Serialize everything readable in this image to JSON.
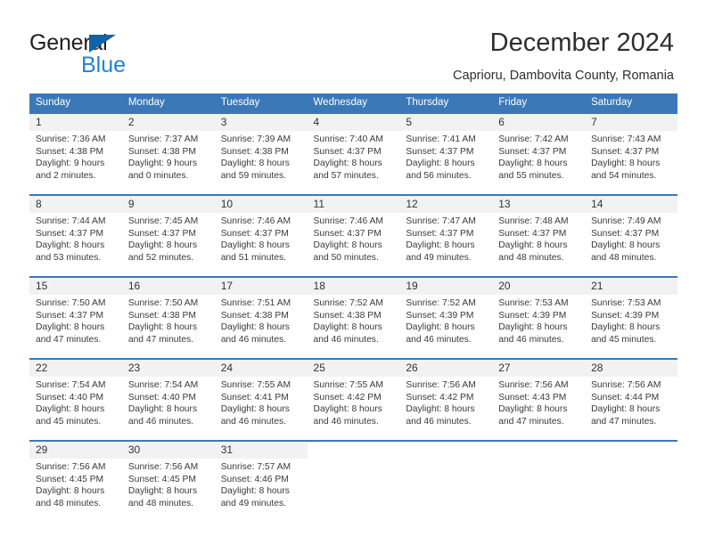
{
  "brand": {
    "name_part1": "General",
    "name_part2": "Blue"
  },
  "header": {
    "title": "December 2024",
    "subtitle": "Caprioru, Dambovita County, Romania"
  },
  "colors": {
    "header_blue": "#3b78b8",
    "logo_blue": "#1e84d6",
    "logo_triangle": "#1063a8",
    "daynum_background": "#f2f2f2"
  },
  "weekday_headers": [
    "Sunday",
    "Monday",
    "Tuesday",
    "Wednesday",
    "Thursday",
    "Friday",
    "Saturday"
  ],
  "labels": {
    "sunrise_prefix": "Sunrise:",
    "sunset_prefix": "Sunset:",
    "daylight_prefix": "Daylight:"
  },
  "weeks": [
    [
      {
        "day": "1",
        "sunrise": "Sunrise: 7:36 AM",
        "sunset": "Sunset: 4:38 PM",
        "daylight": "Daylight: 9 hours and 2 minutes."
      },
      {
        "day": "2",
        "sunrise": "Sunrise: 7:37 AM",
        "sunset": "Sunset: 4:38 PM",
        "daylight": "Daylight: 9 hours and 0 minutes."
      },
      {
        "day": "3",
        "sunrise": "Sunrise: 7:39 AM",
        "sunset": "Sunset: 4:38 PM",
        "daylight": "Daylight: 8 hours and 59 minutes."
      },
      {
        "day": "4",
        "sunrise": "Sunrise: 7:40 AM",
        "sunset": "Sunset: 4:37 PM",
        "daylight": "Daylight: 8 hours and 57 minutes."
      },
      {
        "day": "5",
        "sunrise": "Sunrise: 7:41 AM",
        "sunset": "Sunset: 4:37 PM",
        "daylight": "Daylight: 8 hours and 56 minutes."
      },
      {
        "day": "6",
        "sunrise": "Sunrise: 7:42 AM",
        "sunset": "Sunset: 4:37 PM",
        "daylight": "Daylight: 8 hours and 55 minutes."
      },
      {
        "day": "7",
        "sunrise": "Sunrise: 7:43 AM",
        "sunset": "Sunset: 4:37 PM",
        "daylight": "Daylight: 8 hours and 54 minutes."
      }
    ],
    [
      {
        "day": "8",
        "sunrise": "Sunrise: 7:44 AM",
        "sunset": "Sunset: 4:37 PM",
        "daylight": "Daylight: 8 hours and 53 minutes."
      },
      {
        "day": "9",
        "sunrise": "Sunrise: 7:45 AM",
        "sunset": "Sunset: 4:37 PM",
        "daylight": "Daylight: 8 hours and 52 minutes."
      },
      {
        "day": "10",
        "sunrise": "Sunrise: 7:46 AM",
        "sunset": "Sunset: 4:37 PM",
        "daylight": "Daylight: 8 hours and 51 minutes."
      },
      {
        "day": "11",
        "sunrise": "Sunrise: 7:46 AM",
        "sunset": "Sunset: 4:37 PM",
        "daylight": "Daylight: 8 hours and 50 minutes."
      },
      {
        "day": "12",
        "sunrise": "Sunrise: 7:47 AM",
        "sunset": "Sunset: 4:37 PM",
        "daylight": "Daylight: 8 hours and 49 minutes."
      },
      {
        "day": "13",
        "sunrise": "Sunrise: 7:48 AM",
        "sunset": "Sunset: 4:37 PM",
        "daylight": "Daylight: 8 hours and 48 minutes."
      },
      {
        "day": "14",
        "sunrise": "Sunrise: 7:49 AM",
        "sunset": "Sunset: 4:37 PM",
        "daylight": "Daylight: 8 hours and 48 minutes."
      }
    ],
    [
      {
        "day": "15",
        "sunrise": "Sunrise: 7:50 AM",
        "sunset": "Sunset: 4:37 PM",
        "daylight": "Daylight: 8 hours and 47 minutes."
      },
      {
        "day": "16",
        "sunrise": "Sunrise: 7:50 AM",
        "sunset": "Sunset: 4:38 PM",
        "daylight": "Daylight: 8 hours and 47 minutes."
      },
      {
        "day": "17",
        "sunrise": "Sunrise: 7:51 AM",
        "sunset": "Sunset: 4:38 PM",
        "daylight": "Daylight: 8 hours and 46 minutes."
      },
      {
        "day": "18",
        "sunrise": "Sunrise: 7:52 AM",
        "sunset": "Sunset: 4:38 PM",
        "daylight": "Daylight: 8 hours and 46 minutes."
      },
      {
        "day": "19",
        "sunrise": "Sunrise: 7:52 AM",
        "sunset": "Sunset: 4:39 PM",
        "daylight": "Daylight: 8 hours and 46 minutes."
      },
      {
        "day": "20",
        "sunrise": "Sunrise: 7:53 AM",
        "sunset": "Sunset: 4:39 PM",
        "daylight": "Daylight: 8 hours and 46 minutes."
      },
      {
        "day": "21",
        "sunrise": "Sunrise: 7:53 AM",
        "sunset": "Sunset: 4:39 PM",
        "daylight": "Daylight: 8 hours and 45 minutes."
      }
    ],
    [
      {
        "day": "22",
        "sunrise": "Sunrise: 7:54 AM",
        "sunset": "Sunset: 4:40 PM",
        "daylight": "Daylight: 8 hours and 45 minutes."
      },
      {
        "day": "23",
        "sunrise": "Sunrise: 7:54 AM",
        "sunset": "Sunset: 4:40 PM",
        "daylight": "Daylight: 8 hours and 46 minutes."
      },
      {
        "day": "24",
        "sunrise": "Sunrise: 7:55 AM",
        "sunset": "Sunset: 4:41 PM",
        "daylight": "Daylight: 8 hours and 46 minutes."
      },
      {
        "day": "25",
        "sunrise": "Sunrise: 7:55 AM",
        "sunset": "Sunset: 4:42 PM",
        "daylight": "Daylight: 8 hours and 46 minutes."
      },
      {
        "day": "26",
        "sunrise": "Sunrise: 7:56 AM",
        "sunset": "Sunset: 4:42 PM",
        "daylight": "Daylight: 8 hours and 46 minutes."
      },
      {
        "day": "27",
        "sunrise": "Sunrise: 7:56 AM",
        "sunset": "Sunset: 4:43 PM",
        "daylight": "Daylight: 8 hours and 47 minutes."
      },
      {
        "day": "28",
        "sunrise": "Sunrise: 7:56 AM",
        "sunset": "Sunset: 4:44 PM",
        "daylight": "Daylight: 8 hours and 47 minutes."
      }
    ],
    [
      {
        "day": "29",
        "sunrise": "Sunrise: 7:56 AM",
        "sunset": "Sunset: 4:45 PM",
        "daylight": "Daylight: 8 hours and 48 minutes."
      },
      {
        "day": "30",
        "sunrise": "Sunrise: 7:56 AM",
        "sunset": "Sunset: 4:45 PM",
        "daylight": "Daylight: 8 hours and 48 minutes."
      },
      {
        "day": "31",
        "sunrise": "Sunrise: 7:57 AM",
        "sunset": "Sunset: 4:46 PM",
        "daylight": "Daylight: 8 hours and 49 minutes."
      },
      {
        "day": "",
        "sunrise": "",
        "sunset": "",
        "daylight": ""
      },
      {
        "day": "",
        "sunrise": "",
        "sunset": "",
        "daylight": ""
      },
      {
        "day": "",
        "sunrise": "",
        "sunset": "",
        "daylight": ""
      },
      {
        "day": "",
        "sunrise": "",
        "sunset": "",
        "daylight": ""
      }
    ]
  ]
}
